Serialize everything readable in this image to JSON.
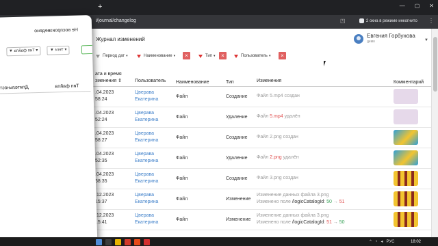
{
  "browser": {
    "newtab_label": "+",
    "url": "i/journal/changelog",
    "incognito": "2 окна в режиме инкогнито",
    "win_min": "—",
    "win_max": "▢",
    "win_close": "✕",
    "menu": "⋮"
  },
  "page": {
    "title": "Журнал изменений",
    "user_name": "Евгения Горбунова",
    "user_role": "демо"
  },
  "filters": [
    {
      "label": "Период дат"
    },
    {
      "label": "Наименование"
    },
    {
      "label": "Тип"
    },
    {
      "label": "Пользователь"
    }
  ],
  "table": {
    "headers": {
      "date": "ата и время",
      "date2": "зменения ⇕",
      "user": "Пользователь",
      "name": "Наименование",
      "type": "Тип",
      "change": "Изменения",
      "comment": "Комментарий"
    },
    "rows": [
      {
        "date": ".04.2023",
        "time": "58:24",
        "user1": "Цверава",
        "user2": "Екатерина",
        "name": "Файл",
        "type": "Создание",
        "change_pre": "Файл 5.mp4 создан",
        "thumb": "lilac"
      },
      {
        "date": ".04.2023",
        "time": "52:24",
        "user1": "Цверава",
        "user2": "Екатерина",
        "name": "Файл",
        "type": "Удаление",
        "change_pre": "Файл ",
        "change_hl": "5.mp4",
        "change_post": " удалён",
        "thumb": "lilac"
      },
      {
        "date": ".04.2023",
        "time": "58:27",
        "user1": "Цверава",
        "user2": "Екатерина",
        "name": "Файл",
        "type": "Создание",
        "change_pre": "Файл 2.png создан",
        "thumb": "birds"
      },
      {
        "date": ".04.2023",
        "time": "52:35",
        "user1": "Цверава",
        "user2": "Екатерина",
        "name": "Файл",
        "type": "Удаление",
        "change_pre": "Файл ",
        "change_hl": "2.png",
        "change_post": " удалён",
        "thumb": "birds"
      },
      {
        "date": ".04.2023",
        "time": "58:35",
        "user1": "Цверава",
        "user2": "Екатерина",
        "name": "Файл",
        "type": "Создание",
        "change_pre": "Файл 3.png создан",
        "thumb": "food"
      },
      {
        "date": ".12.2023",
        "time": "15:37",
        "user1": "Цверава",
        "user2": "Екатерина",
        "name": "Файл",
        "type": "Изменение",
        "line1": "Изменение данных файла 3.png",
        "line2_pre": "Изменено поле ",
        "field": "/logicCatalogId",
        "from": "50",
        "to": "51",
        "from_color": "green",
        "to_color": "red",
        "thumb": "food"
      },
      {
        "date": ".12.2023",
        "time": "15:41",
        "user1": "Цверава",
        "user2": "Екатерина",
        "name": "Файл",
        "type": "Изменение",
        "line1": "Изменение данных файла 3.png",
        "line2_pre": "Изменено поле ",
        "field": "/logicCatalogId",
        "from": "51",
        "to": "50",
        "from_color": "red",
        "to_color": "green",
        "thumb": "food"
      }
    ]
  },
  "left_window": {
    "title": "Не воспроизведено",
    "filter_green": "",
    "filter_tags": "Теги",
    "filter_filetype": "Тип файла",
    "col_type": "Тип файла",
    "col_duration": "Длительность"
  },
  "taskbar": {
    "lang": "РУС",
    "time": "18:02"
  }
}
